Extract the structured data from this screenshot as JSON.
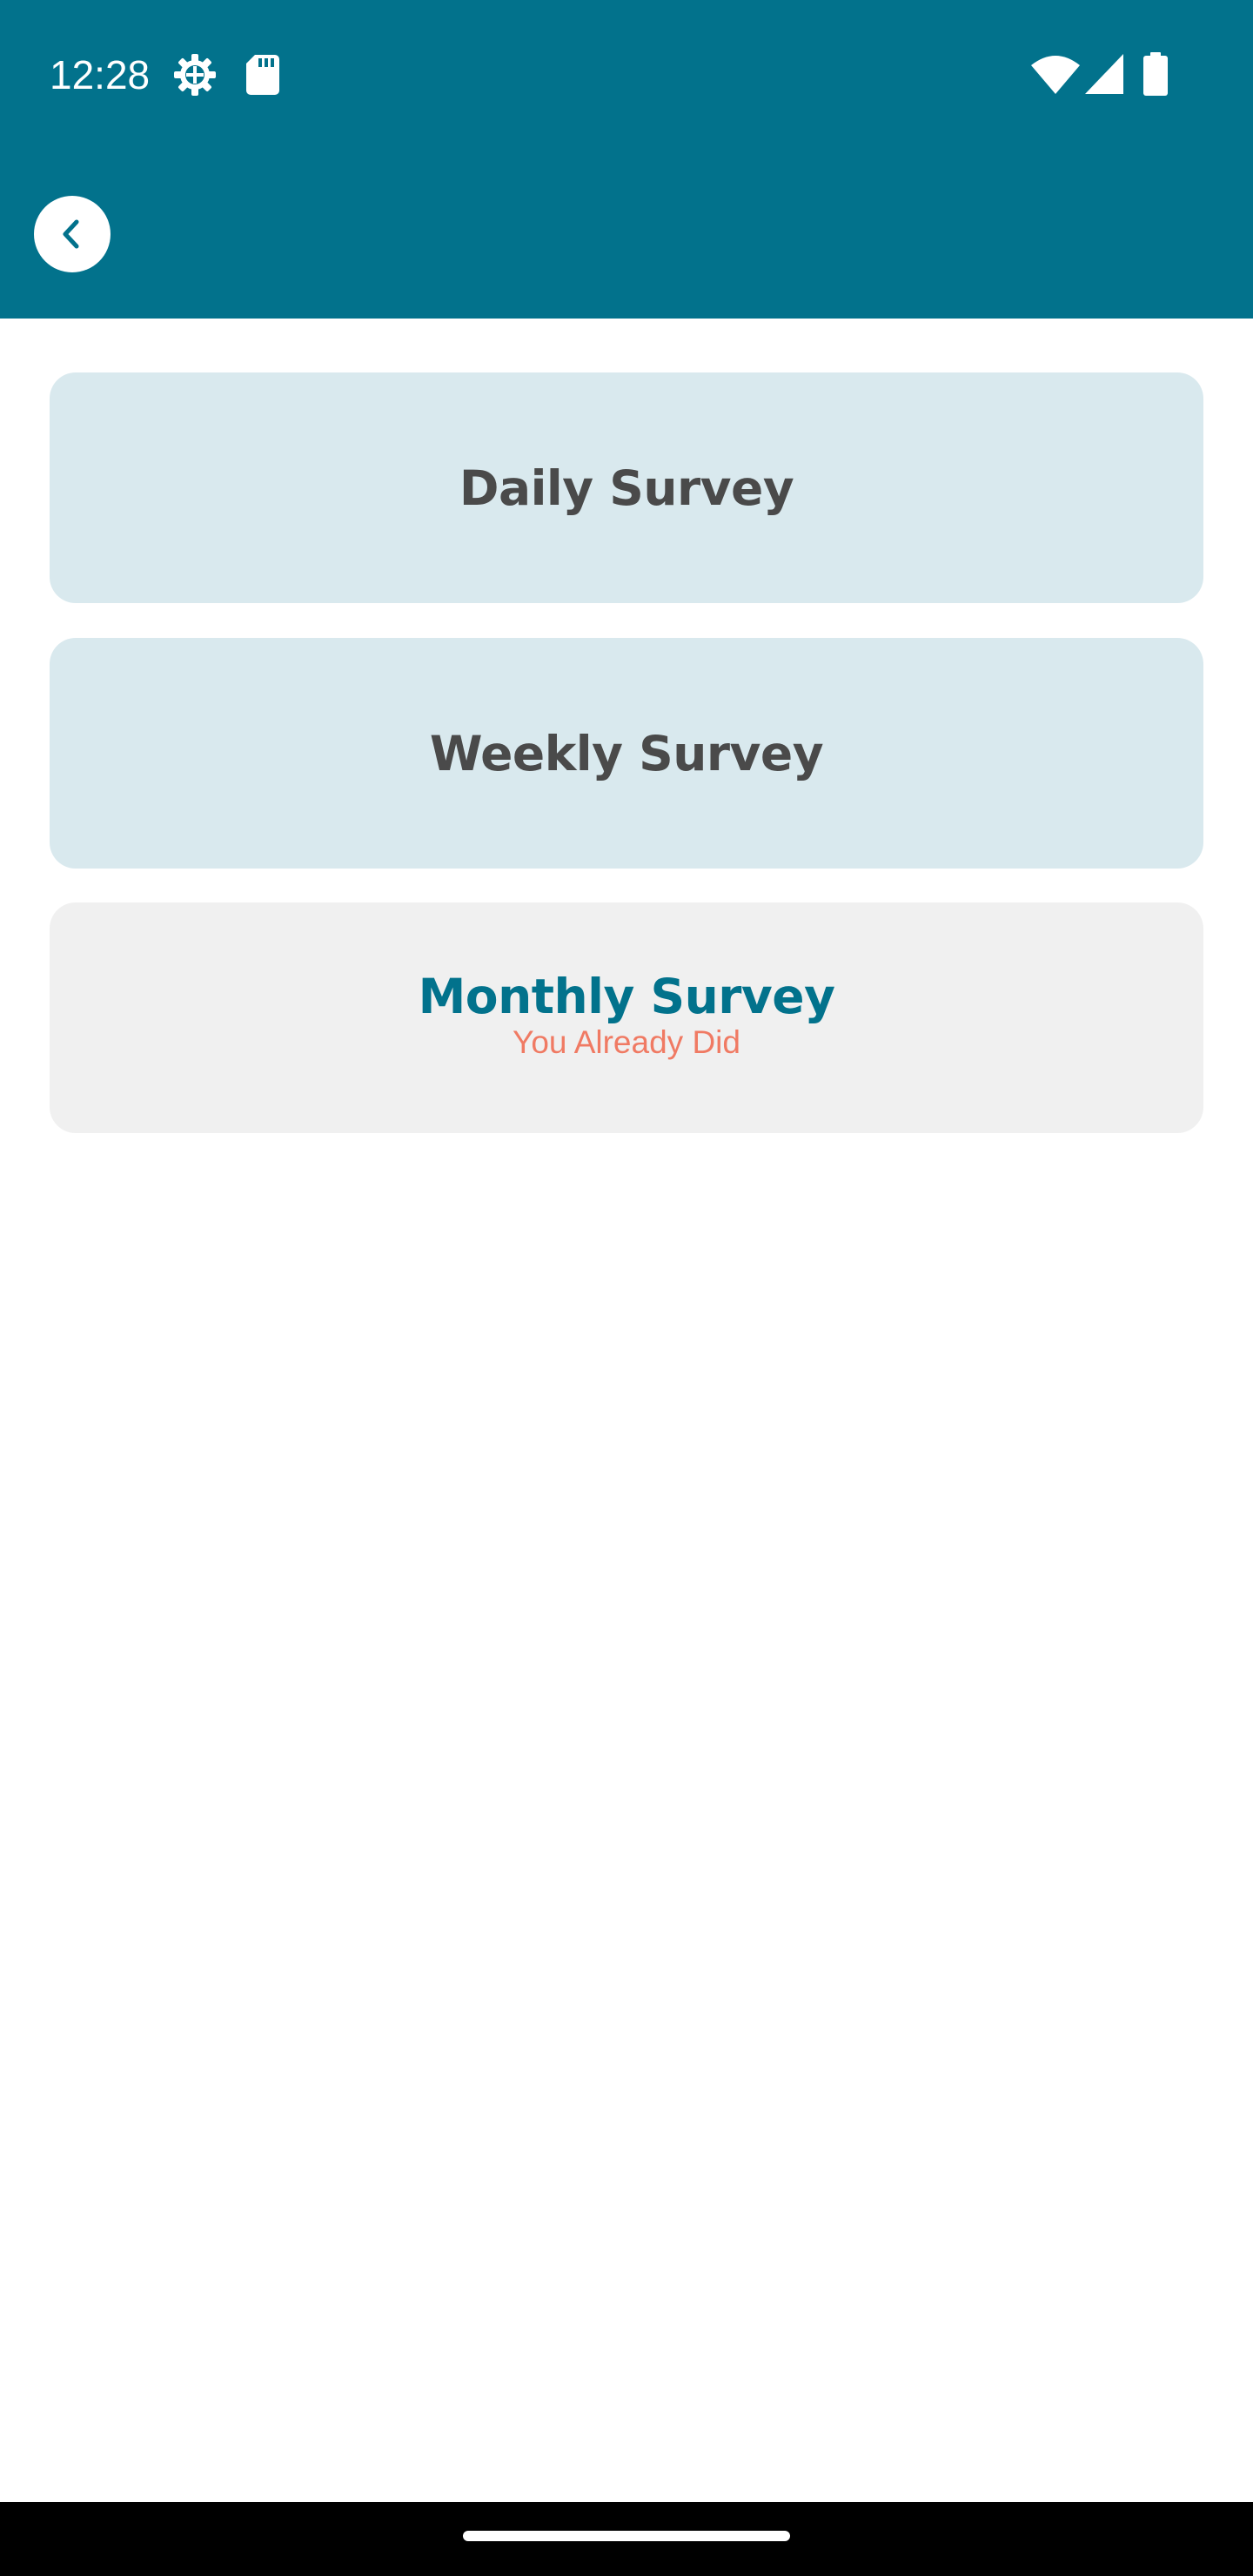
{
  "status_bar": {
    "time": "12:28",
    "icons": [
      "settings-gear-icon",
      "sd-card-icon",
      "wifi-icon",
      "cell-signal-icon",
      "battery-icon"
    ]
  },
  "header": {
    "back_icon": "chevron-left-icon"
  },
  "surveys": [
    {
      "title": "Daily Survey",
      "subtitle": ""
    },
    {
      "title": "Weekly Survey",
      "subtitle": ""
    },
    {
      "title": "Monthly Survey",
      "subtitle": "You Already Did"
    }
  ],
  "colors": {
    "primary": "#02728C",
    "card_active": "#D9E9EE",
    "card_done": "#F0F0F0",
    "title_text": "#4A4A4A",
    "done_subtitle": "#F07A63"
  }
}
